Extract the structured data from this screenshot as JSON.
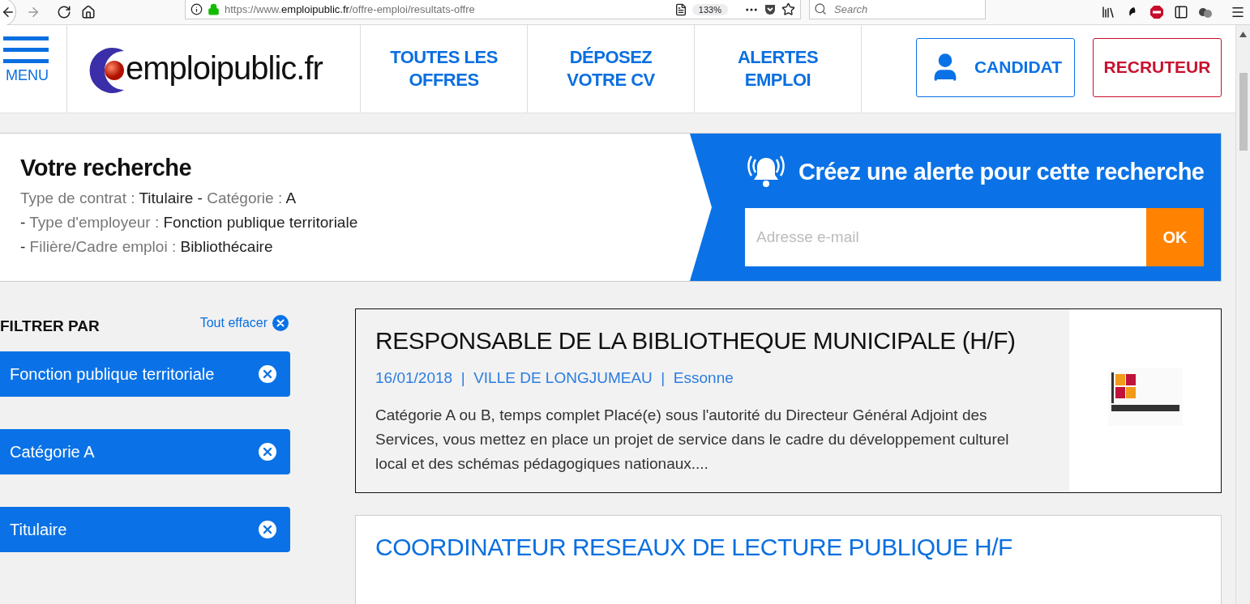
{
  "browser": {
    "url": {
      "prefix": "https://www.",
      "domain": "emploipublic.fr",
      "path": "/offre-emploi/resultats-offre"
    },
    "zoom": "133%",
    "search": {
      "placeholder": "Search"
    }
  },
  "header": {
    "menu_label": "MENU",
    "logo_text": "emploipublic.fr",
    "nav": [
      {
        "label": "TOUTES LES OFFRES"
      },
      {
        "label": "DÉPOSEZ VOTRE CV"
      },
      {
        "label": "ALERTES EMPLOI"
      }
    ],
    "buttons": [
      {
        "kind": "candidate",
        "label": "CANDIDAT"
      },
      {
        "kind": "recruiter",
        "label": "RECRUTEUR"
      }
    ]
  },
  "search_summary": {
    "title": "Votre recherche",
    "lines": [
      [
        {
          "label": "Type de contrat :",
          "value": "Titulaire"
        },
        {
          "prefix": "-",
          "label": "Catégorie :",
          "value": "A"
        }
      ],
      [
        {
          "prefix": "-",
          "label": "Type d'employeur :",
          "value": "Fonction publique territoriale"
        }
      ],
      [
        {
          "prefix": "-",
          "label": "Filière/Cadre emploi :",
          "value": "Bibliothécaire"
        }
      ]
    ]
  },
  "alert": {
    "title": "Créez une alerte pour cette recherche",
    "email": {
      "placeholder": "Adresse e-mail"
    },
    "button": "OK"
  },
  "filters": {
    "title": "FILTRER PAR",
    "clear_label": "Tout effacer",
    "chips": [
      {
        "label": "Fonction publique territoriale"
      },
      {
        "label": "Catégorie A"
      },
      {
        "label": "Titulaire"
      }
    ]
  },
  "results": [
    {
      "title": "RESPONSABLE DE LA BIBLIOTHEQUE MUNICIPALE (H/F)",
      "highlighted": true,
      "meta": [
        "16/01/2018",
        "VILLE DE LONGJUMEAU",
        "Essonne"
      ],
      "meta_separator": "|",
      "description": "Catégorie A ou B, temps complet Placé(e) sous l'autorité du Directeur Général Adjoint des Services, vous mettez en place un projet de service dans le cadre du développement culturel local et des schémas pédagogiques nationaux...."
    },
    {
      "title": "COORDINATEUR RESEAUX DE LECTURE PUBLIQUE H/F",
      "highlighted": false
    }
  ]
}
